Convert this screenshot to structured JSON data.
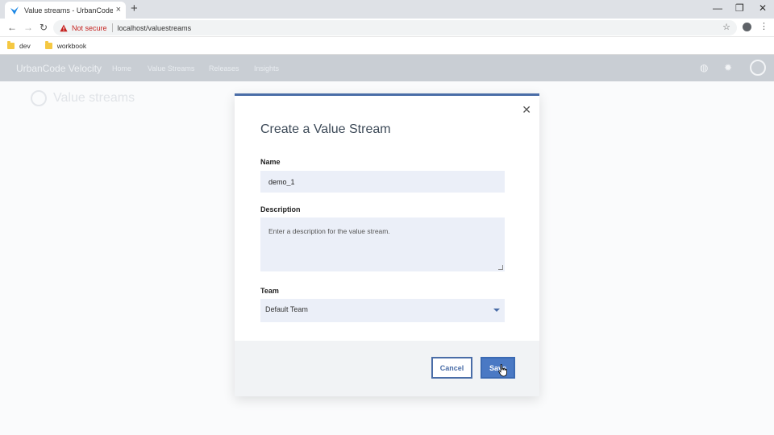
{
  "browser": {
    "tab_title": "Value streams - UrbanCode Velo",
    "new_tab_label": "+",
    "not_secure_label": "Not secure",
    "url": "localhost/valuestreams",
    "bookmarks": [
      {
        "label": "dev"
      },
      {
        "label": "workbook"
      }
    ],
    "window_controls": {
      "minimize": "—",
      "restore": "❐",
      "close": "✕"
    }
  },
  "app_header": {
    "brand": "UrbanCode Velocity",
    "nav": [
      "Home",
      "Value Streams",
      "Releases",
      "Insights"
    ]
  },
  "page": {
    "title": "Value streams"
  },
  "modal": {
    "title": "Create a Value Stream",
    "close_glyph": "✕",
    "name_label": "Name",
    "name_value": "demo_1",
    "description_label": "Description",
    "description_placeholder": "Enter a description for the value stream.",
    "team_label": "Team",
    "team_value": "Default Team",
    "cancel_label": "Cancel",
    "save_label": "Save"
  },
  "colors": {
    "accent": "#4a6da7",
    "save_button": "#4a79c4",
    "not_secure": "#c5221f"
  }
}
